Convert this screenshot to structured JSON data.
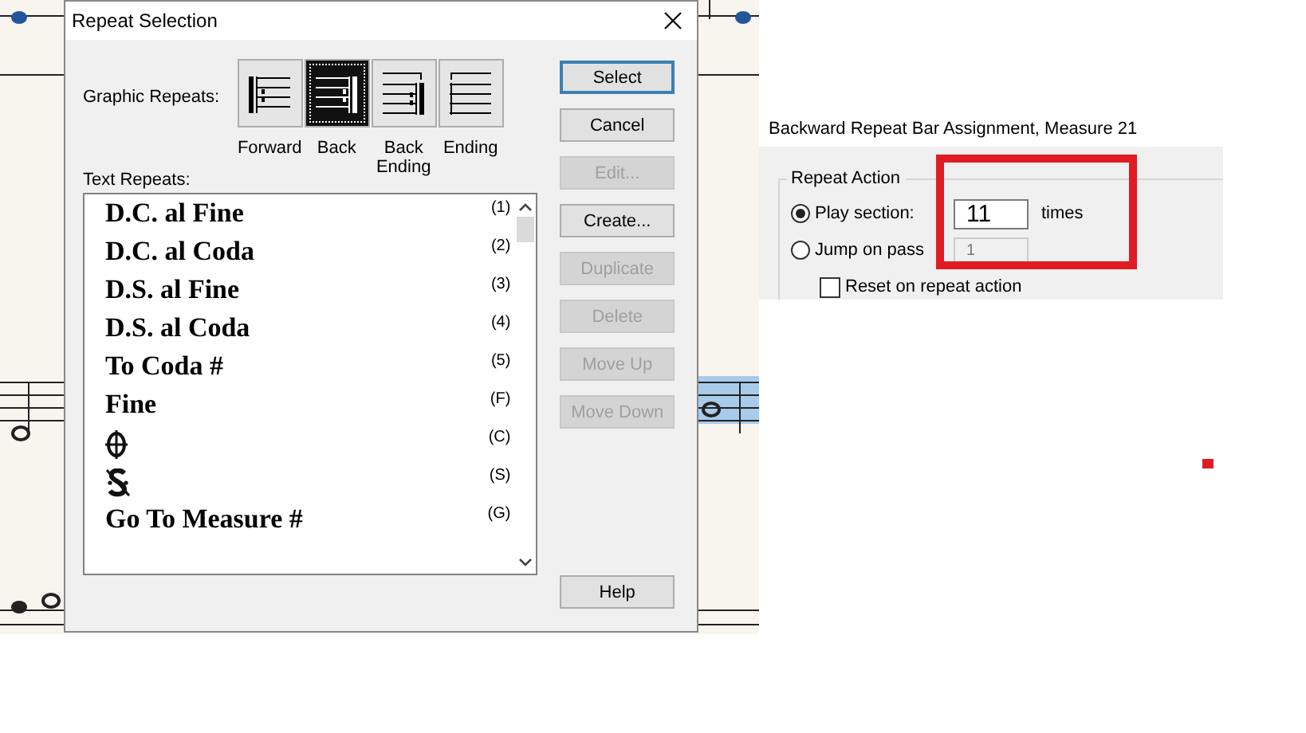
{
  "dialog": {
    "title": "Repeat Selection",
    "graphic_repeats_label": "Graphic Repeats:",
    "graphic_repeats": [
      {
        "kind": "forward",
        "label": "Forward",
        "selected": false
      },
      {
        "kind": "back",
        "label": "Back",
        "selected": true
      },
      {
        "kind": "back_ending",
        "label": "Back Ending",
        "selected": false
      },
      {
        "kind": "ending",
        "label": "Ending",
        "selected": false
      }
    ],
    "text_repeats_label": "Text Repeats:",
    "text_repeats": [
      {
        "kind": "text",
        "text": "D.C. al Fine",
        "shortcut": "(1)"
      },
      {
        "kind": "text",
        "text": "D.C. al Coda",
        "shortcut": "(2)"
      },
      {
        "kind": "text",
        "text": "D.S. al Fine",
        "shortcut": "(3)"
      },
      {
        "kind": "text",
        "text": "D.S. al Coda",
        "shortcut": "(4)"
      },
      {
        "kind": "text",
        "text": "To Coda #",
        "shortcut": "(5)"
      },
      {
        "kind": "text",
        "text": "Fine",
        "shortcut": "(F)"
      },
      {
        "kind": "coda",
        "shortcut": "(C)"
      },
      {
        "kind": "segno",
        "shortcut": "(S)"
      },
      {
        "kind": "text",
        "text": "Go To Measure #",
        "shortcut": "(G)"
      }
    ],
    "buttons": [
      {
        "label": "Select",
        "disabled": false,
        "default": true
      },
      {
        "label": "Cancel",
        "disabled": false,
        "default": false
      },
      {
        "label": "Edit...",
        "disabled": true,
        "default": false
      },
      {
        "label": "Create...",
        "disabled": false,
        "default": false
      },
      {
        "label": "Duplicate",
        "disabled": true,
        "default": false
      },
      {
        "label": "Delete",
        "disabled": true,
        "default": false
      },
      {
        "label": "Move Up",
        "disabled": true,
        "default": false
      },
      {
        "label": "Move Down",
        "disabled": true,
        "default": false
      }
    ],
    "help_button": "Help"
  },
  "assignment_panel": {
    "title": "Backward Repeat Bar Assignment, Measure 21",
    "group_label": "Repeat Action",
    "play_section": {
      "label": "Play section:",
      "selected": true,
      "value": "11",
      "unit": "times"
    },
    "jump_on_pass": {
      "label": "Jump on pass",
      "selected": false,
      "value": "1",
      "disabled": true
    },
    "reset_on_repeat": {
      "label": "Reset on repeat action",
      "checked": false
    }
  }
}
